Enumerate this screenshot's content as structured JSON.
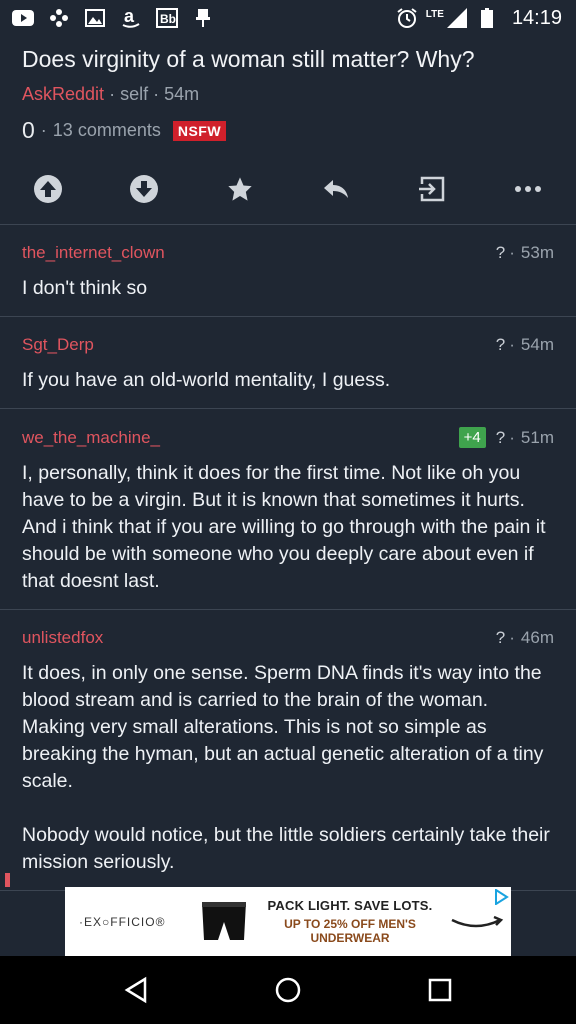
{
  "status_bar": {
    "time": "14:19",
    "network": "LTE",
    "icons": [
      "youtube-icon",
      "pinwheel-icon",
      "image-icon",
      "amazon-icon",
      "bb-icon",
      "pin-icon",
      "alarm-icon",
      "signal-icon",
      "battery-icon"
    ]
  },
  "post": {
    "title": "Does virginity of a woman still matter? Why?",
    "subreddit": "AskReddit",
    "separator": "·",
    "type": "self",
    "age": "54m",
    "score": "0",
    "comments": "13 comments",
    "nsfw": "NSFW"
  },
  "actions": [
    "upvote-icon",
    "downvote-icon",
    "star-icon",
    "reply-icon",
    "open-icon",
    "more-icon"
  ],
  "comments": [
    {
      "author": "the_internet_clown",
      "flair": "?",
      "age": "53m",
      "body": [
        "I don't think so"
      ]
    },
    {
      "author": "Sgt_Derp",
      "flair": "?",
      "age": "54m",
      "body": [
        "If you have an old-world mentality, I guess."
      ]
    },
    {
      "author": "we_the_machine_",
      "score_badge": "+4",
      "flair": "?",
      "age": "51m",
      "body": [
        "I, personally, think it does for the first time. Not like oh you have to be a virgin. But it is known that sometimes it hurts. And i think that if you are willing to go through with the pain it should be with someone who you deeply care about even if that doesnt last."
      ]
    },
    {
      "author": "unlistedfox",
      "flair": "?",
      "age": "46m",
      "body": [
        "It does, in only one sense. Sperm DNA finds it's way into the blood stream and is carried to the brain of the woman. Making very small alterations. This is not so simple as breaking the hyman, but an actual genetic alteration of a tiny scale.",
        "Nobody would notice, but the little soldiers certainly take their mission seriously."
      ]
    }
  ],
  "ad": {
    "brand": "·EX○FFICIO®",
    "headline": "PACK LIGHT. SAVE LOTS.",
    "subline": "UP TO 25% OFF MEN'S UNDERWEAR"
  },
  "colors": {
    "background": "#1f2733",
    "accent": "#e0555f",
    "nsfw": "#d0202b",
    "score_badge": "#3fa34d"
  }
}
